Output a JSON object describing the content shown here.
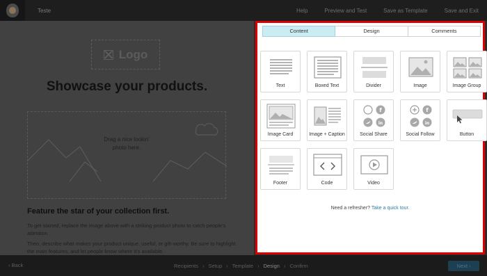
{
  "topbar": {
    "campaign_name": "Teste",
    "nav": [
      "Help",
      "Preview and Test",
      "Save as Template",
      "Save and Exit"
    ]
  },
  "canvas": {
    "logo_placeholder": "Logo",
    "headline": "Showcase your products.",
    "hero_placeholder_line1": "Drag a nice lookin'",
    "hero_placeholder_line2": "photo here.",
    "feature_title": "Feature the star of your collection first.",
    "paragraph1": "To get started, replace the image above with a striking product photo to catch people's attention.",
    "paragraph2": "Then, describe what makes your product unique, useful, or gift-worthy. Be sure to highlight the main features, and let people know where it's available."
  },
  "panel": {
    "tabs": [
      {
        "label": "Content",
        "active": true
      },
      {
        "label": "Design",
        "active": false
      },
      {
        "label": "Comments",
        "active": false
      }
    ],
    "blocks": [
      {
        "label": "Text",
        "icon": "text-block-icon"
      },
      {
        "label": "Boxed Text",
        "icon": "boxed-text-block-icon"
      },
      {
        "label": "Divider",
        "icon": "divider-block-icon"
      },
      {
        "label": "Image",
        "icon": "image-block-icon"
      },
      {
        "label": "Image Group",
        "icon": "image-group-block-icon"
      },
      {
        "label": "Image Card",
        "icon": "image-card-block-icon"
      },
      {
        "label": "Image + Caption",
        "icon": "image-caption-block-icon"
      },
      {
        "label": "Social Share",
        "icon": "social-share-block-icon"
      },
      {
        "label": "Social Follow",
        "icon": "social-follow-block-icon"
      },
      {
        "label": "Button",
        "icon": "button-block-icon"
      },
      {
        "label": "Footer",
        "icon": "footer-block-icon"
      },
      {
        "label": "Code",
        "icon": "code-block-icon"
      },
      {
        "label": "Video",
        "icon": "video-block-icon"
      }
    ],
    "refresher_text": "Need a refresher?",
    "refresher_link": "Take a quick tour."
  },
  "bottombar": {
    "back_label": "‹ Back",
    "steps": [
      {
        "label": "Recipients",
        "active": false
      },
      {
        "label": "Setup",
        "active": false
      },
      {
        "label": "Template",
        "active": false
      },
      {
        "label": "Design",
        "active": true
      },
      {
        "label": "Confirm",
        "active": false
      }
    ],
    "next_label": "Next ›"
  },
  "colors": {
    "panel_border": "#dd0000",
    "active_tab": "#c9edf3",
    "link": "#2f7ea3",
    "next_button": "#1d3f52"
  }
}
